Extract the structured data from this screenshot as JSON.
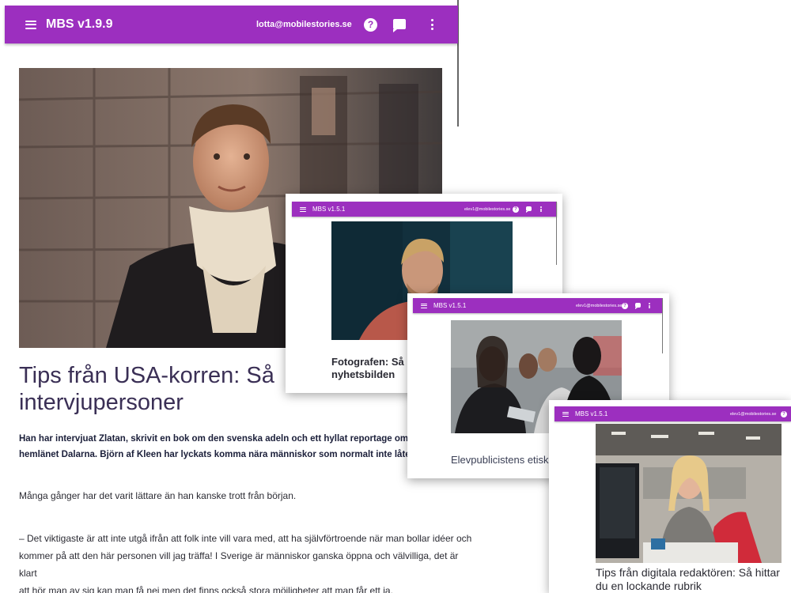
{
  "main": {
    "appbar": {
      "title": "MBS v1.9.9",
      "email": "lotta@mobilestories.se",
      "help_glyph": "?"
    },
    "hero_alt": "Porträtt av man i vit polotröja och svart rock framför en fasad",
    "title": "Tips från USA-korren: Så får du intervjupersoner",
    "title_visible_line1": "Tips från USA-korren: Så",
    "title_visible_line2": "intervjupersoner",
    "lead_line1": "Han har intervjuat Zlatan, skrivit en bok om den svenska adeln och ett hyllat reportage om na",
    "lead_line2": "hemlänet Dalarna. Björn af Kleen har lyckats komma nära människor som normalt inte låter s",
    "para1": "Många gånger har det varit lättare än han kanske trott från början.",
    "para2_line1": "– Det viktigaste är att inte utgå ifrån att folk inte vill vara med, att ha självförtroende när man bollar idéer och",
    "para2_line2": "kommer på att den här personen vill jag träffa! I Sverige är människor ganska öppna och välvilliga, det är klart",
    "para2_line3": "att hör man av sig kan man få nej men det finns också stora möjligheter att man får ett ja."
  },
  "window1": {
    "appbar": {
      "title": "MBS v1.5.1",
      "email": "elev1@mobilestories.se",
      "help_glyph": "?"
    },
    "caption_line1": "Fotografen: Så",
    "caption_line2": "nyhetsbilden"
  },
  "window2": {
    "appbar": {
      "title": "MBS v1.5.1",
      "email": "elev1@mobilestories.se",
      "help_glyph": "?"
    },
    "caption": "Elevpublicistens etiska"
  },
  "window3": {
    "appbar": {
      "title": "MBS v1.5.1",
      "email": "elev1@mobilestories.se",
      "help_glyph": "?"
    },
    "caption_line1": "Tips från digitala redaktören: Så hittar",
    "caption_line2": "du en lockande rubrik"
  },
  "colors": {
    "appbar": "#9c2fbf",
    "title_text": "#3a2f55"
  }
}
